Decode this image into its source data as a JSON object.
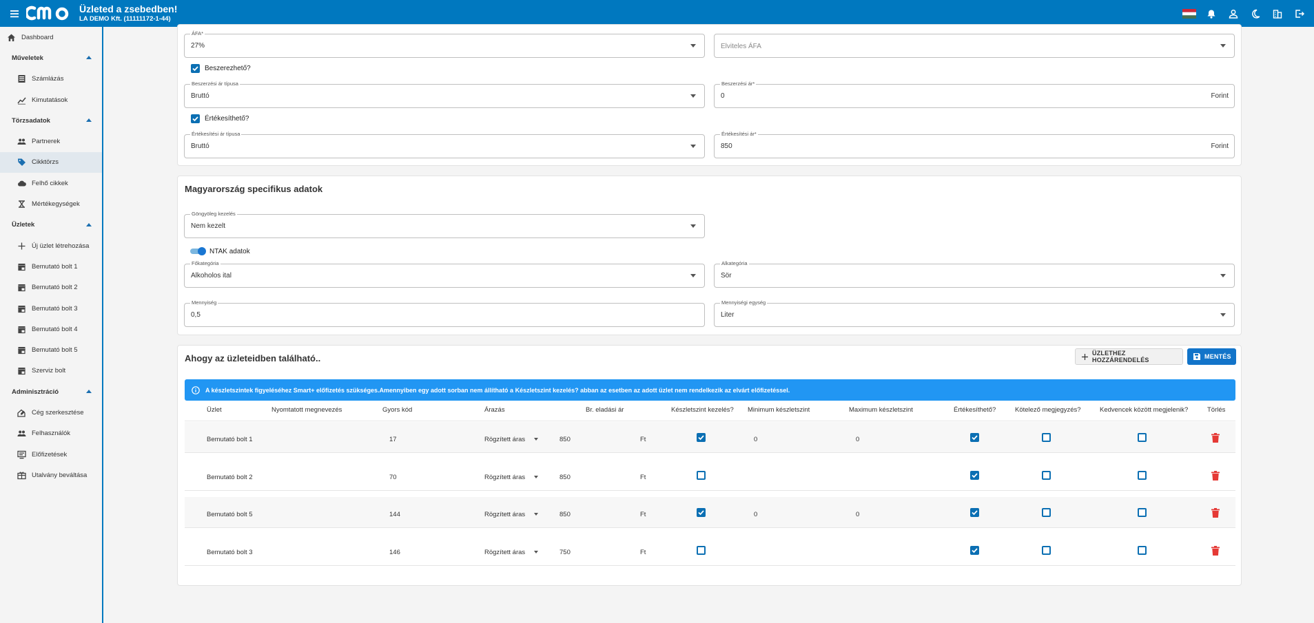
{
  "topbar": {
    "brand": "cmo",
    "title": "Üzleted a zsebedben!",
    "company": "LA DEMO Kft. (11111172-1-44)",
    "icons": [
      "hungarian-flag-icon",
      "bell-icon",
      "user-icon",
      "moon-icon",
      "building-icon",
      "logout-icon"
    ]
  },
  "sidebar": {
    "dashboard": "Dashboard",
    "sections": [
      {
        "label": "Műveletek",
        "items": [
          "Számlázás",
          "Kimutatások"
        ]
      },
      {
        "label": "Törzsadatok",
        "items": [
          "Partnerek",
          "Cikktörzs",
          "Felhő cikkek",
          "Mértékegységek"
        ]
      },
      {
        "label": "Üzletek",
        "items": [
          "Új üzlet létrehozása",
          "Bemutató bolt 1",
          "Bemutató bolt 2",
          "Bemutató bolt 3",
          "Bemutató bolt 4",
          "Bemutató bolt 5",
          "Szerviz bolt"
        ]
      },
      {
        "label": "Adminisztráció",
        "items": [
          "Cég szerkesztése",
          "Felhasználók",
          "Előfizetések",
          "Utalvány beváltása"
        ]
      }
    ],
    "active": "Cikktörzs"
  },
  "card1": {
    "afa_label": "ÁFA*",
    "afa_value": "27%",
    "elviteles_placeholder": "Elviteles ÁFA",
    "beszerezheto_label": "Beszerezhető?",
    "beszerzesi_tipus_label": "Beszerzési ár típusa",
    "beszerzesi_tipus_value": "Bruttó",
    "beszerzesi_ar_label": "Beszerzési ár*",
    "beszerzesi_ar_value": "0",
    "currency": "Forint",
    "ertekesitheto_label": "Értékesíthető?",
    "ertekesitesi_tipus_label": "Értékesítési ár típusa",
    "ertekesitesi_tipus_value": "Bruttó",
    "ertekesitesi_ar_label": "Értékesítési ár*",
    "ertekesitesi_ar_value": "850"
  },
  "card2": {
    "title": "Magyarország specifikus adatok",
    "gongyoleg_label": "Göngyöleg kezelés",
    "gongyoleg_value": "Nem kezelt",
    "ntak_label": "NTAK adatok",
    "fokategoria_label": "Főkategória",
    "fokategoria_value": "Alkoholos ital",
    "alkategoria_label": "Alkategória",
    "alkategoria_value": "Sör",
    "mennyiseg_label": "Mennyiség",
    "mennyiseg_value": "0,5",
    "mennyisegi_egyseg_label": "Mennyiségi egység",
    "mennyisegi_egyseg_value": "Liter"
  },
  "card3": {
    "title": "Ahogy az üzleteidben található..",
    "assign_button": "ÜZLETHEZ HOZZÁRENDELÉS",
    "save_button": "MENTÉS",
    "info": "A készletszintek figyeléséhez Smart+ előfizetés szükséges.Amennyiben egy adott sorban nem állítható a Készletszint kezelés? abban az esetben az adott üzlet nem rendelkezik az elvárt előfizetéssel.",
    "columns": [
      "Üzlet",
      "Nyomtatott megnevezés",
      "Gyors kód",
      "Árazás",
      "Br. eladási ár",
      "Készletszint kezelés?",
      "Minimum készletszint",
      "Maximum készletszint",
      "Értékesíthető?",
      "Kötelező megjegyzés?",
      "Kedvencek között megjelenik?",
      "Törlés"
    ],
    "rows": [
      {
        "store": "Bemutató bolt 1",
        "code": "17",
        "pricing": "Rögzített áras",
        "price": "850",
        "unit": "Ft",
        "stock": true,
        "min": "0",
        "max": "0",
        "sellable": true,
        "mandatory": false,
        "favorite": false
      },
      {
        "store": "Bemutató bolt 2",
        "code": "70",
        "pricing": "Rögzített áras",
        "price": "850",
        "unit": "Ft",
        "stock": false,
        "min": "",
        "max": "",
        "sellable": true,
        "mandatory": false,
        "favorite": false
      },
      {
        "store": "Bemutató bolt 5",
        "code": "144",
        "pricing": "Rögzített áras",
        "price": "850",
        "unit": "Ft",
        "stock": true,
        "min": "0",
        "max": "0",
        "sellable": true,
        "mandatory": false,
        "favorite": false
      },
      {
        "store": "Bemutató bolt 3",
        "code": "146",
        "pricing": "Rögzített áras",
        "price": "750",
        "unit": "Ft",
        "stock": false,
        "min": "",
        "max": "",
        "sellable": true,
        "mandatory": false,
        "favorite": false
      }
    ]
  },
  "colors": {
    "primary": "#0078bf",
    "info": "#2196f3",
    "checkbox": "#0b6fb3",
    "delete": "#e53935"
  }
}
